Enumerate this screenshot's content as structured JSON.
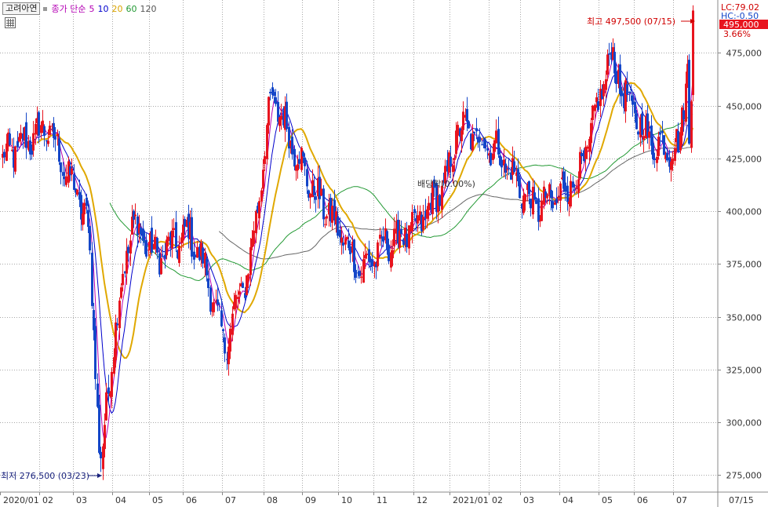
{
  "header": {
    "stock_name": "고려아연",
    "ma_label": "종가 단순",
    "ma_periods": [
      {
        "period": "5",
        "color": "#b400b4"
      },
      {
        "period": "10",
        "color": "#0000cc"
      },
      {
        "period": "20",
        "color": "#d9a300"
      },
      {
        "period": "60",
        "color": "#229933"
      },
      {
        "period": "120",
        "color": "#555555"
      }
    ]
  },
  "right_info": {
    "lc": "LC:79.02",
    "hc": "HC:-0.50",
    "current_price": "495,000",
    "change_pct": "3.66%"
  },
  "annotations": {
    "high_label": "최고 497,500 (07/15)",
    "low_label": "최저 276,500 (03/23)",
    "dividend_label": "배당락(0.00%)"
  },
  "colors": {
    "up": "#e8141e",
    "down": "#1446c8",
    "ma5": "#b400b4",
    "ma10": "#0000cc",
    "ma20": "#e0a800",
    "ma60": "#229933",
    "ma120": "#666666",
    "grid": "#a8a8a8"
  },
  "chart_data": {
    "type": "candlestick",
    "y_axis": {
      "ticks": [
        275000,
        300000,
        325000,
        350000,
        375000,
        400000,
        425000,
        450000,
        475000
      ],
      "tick_labels": [
        "275,000",
        "300,000",
        "325,000",
        "350,000",
        "375,000",
        "400,000",
        "425,000",
        "450,000",
        "475,000"
      ],
      "range": [
        267000,
        500000
      ]
    },
    "x_axis": {
      "labels": [
        "2020/01",
        "02",
        "03",
        "04",
        "05",
        "06",
        "07",
        "08",
        "09",
        "10",
        "11",
        "12",
        "2021/01",
        "02",
        "03",
        "04",
        "05",
        "06",
        "07",
        "07/15"
      ]
    },
    "price_path": [
      {
        "month": "2020/01",
        "close": 425000
      },
      {
        "month": "02",
        "close": 440000
      },
      {
        "month": "02",
        "close": 405000
      },
      {
        "month": "03",
        "close": 395000
      },
      {
        "month": "03",
        "close": 277000
      },
      {
        "month": "04",
        "close": 345000
      },
      {
        "month": "04",
        "close": 395000
      },
      {
        "month": "05",
        "close": 378000
      },
      {
        "month": "06",
        "close": 390000
      },
      {
        "month": "06",
        "close": 372000
      },
      {
        "month": "07",
        "close": 336000
      },
      {
        "month": "07",
        "close": 375000
      },
      {
        "month": "08",
        "close": 455000
      },
      {
        "month": "09",
        "close": 410000
      },
      {
        "month": "10",
        "close": 398000
      },
      {
        "month": "10",
        "close": 372000
      },
      {
        "month": "11",
        "close": 385000
      },
      {
        "month": "12",
        "close": 392000
      },
      {
        "month": "2021/01",
        "close": 415000
      },
      {
        "month": "2021/01",
        "close": 440000
      },
      {
        "month": "02",
        "close": 430000
      },
      {
        "month": "03",
        "close": 402000
      },
      {
        "month": "04",
        "close": 405000
      },
      {
        "month": "04",
        "close": 418000
      },
      {
        "month": "05",
        "close": 475000
      },
      {
        "month": "05",
        "close": 455000
      },
      {
        "month": "06",
        "close": 432000
      },
      {
        "month": "07",
        "close": 430000
      },
      {
        "month": "07",
        "close": 495000
      }
    ]
  }
}
